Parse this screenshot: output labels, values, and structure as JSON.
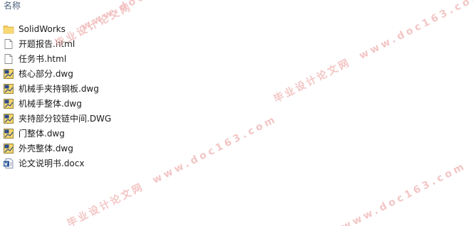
{
  "header": {
    "name_column": "名称"
  },
  "files": [
    {
      "name": "SolidWorks",
      "icon": "folder-icon"
    },
    {
      "name": "开题报告.html",
      "icon": "html-file-icon"
    },
    {
      "name": "任务书.html",
      "icon": "html-file-icon"
    },
    {
      "name": "核心部分.dwg",
      "icon": "dwg-file-icon"
    },
    {
      "name": "机械手夹持钢板.dwg",
      "icon": "dwg-file-icon"
    },
    {
      "name": "机械手整体.dwg",
      "icon": "dwg-file-icon"
    },
    {
      "name": "夹持部分铰链中间.DWG",
      "icon": "dwg-file-icon"
    },
    {
      "name": "门整体.dwg",
      "icon": "dwg-file-icon"
    },
    {
      "name": "外壳整体.dwg",
      "icon": "dwg-file-icon"
    },
    {
      "name": "论文说明书.docx",
      "icon": "word-doc-icon"
    }
  ],
  "watermark": {
    "cn": "毕业设计论文网",
    "en": "www.doc163.com"
  }
}
